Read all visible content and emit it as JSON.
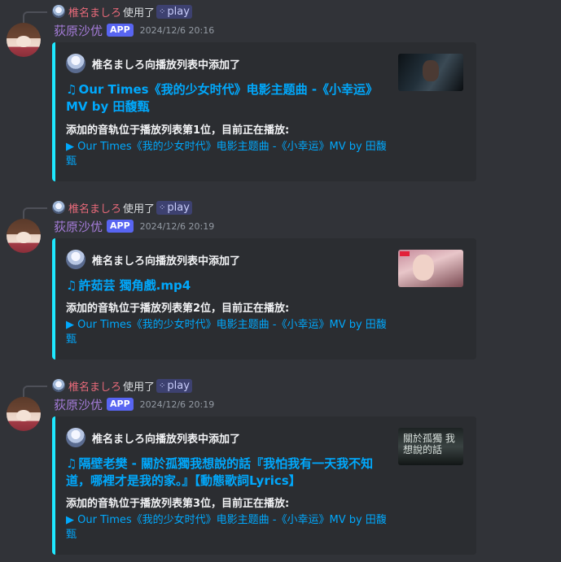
{
  "messages": [
    {
      "reply": {
        "user": "椎名ましろ",
        "verb": "使用了",
        "command": "play"
      },
      "author": {
        "name": "荻原沙优",
        "badge": "APP",
        "timestamp": "2024/12/6 20:16"
      },
      "embed": {
        "author_text": "椎名ましろ向播放列表中添加了",
        "title_icon": "♫",
        "title": "Our Times《我的少女时代》电影主题曲 -《小幸运》MV by 田馥甄",
        "field_name": "添加的音轨位于播放列表第1位，目前正在播放:",
        "field_value": "▶ Our Times《我的少女时代》电影主题曲 -《小幸运》MV by 田馥甄"
      }
    },
    {
      "reply": {
        "user": "椎名ましろ",
        "verb": "使用了",
        "command": "play"
      },
      "author": {
        "name": "荻原沙优",
        "badge": "APP",
        "timestamp": "2024/12/6 20:19"
      },
      "embed": {
        "author_text": "椎名ましろ向播放列表中添加了",
        "title_icon": "♫",
        "title": "許茹芸 獨角戲.mp4",
        "field_name": "添加的音轨位于播放列表第2位，目前正在播放:",
        "field_value": "▶ Our Times《我的少女时代》电影主题曲 -《小幸运》MV by 田馥甄"
      }
    },
    {
      "reply": {
        "user": "椎名ましろ",
        "verb": "使用了",
        "command": "play"
      },
      "author": {
        "name": "荻原沙优",
        "badge": "APP",
        "timestamp": "2024/12/6 20:19"
      },
      "embed": {
        "author_text": "椎名ましろ向播放列表中添加了",
        "title_icon": "♫",
        "title": "隔壁老樊 - 關於孤獨我想說的話『我怕我有一天我不知道，哪裡才是我的家。』【動態歌詞Lyrics】",
        "field_name": "添加的音轨位于播放列表第3位，目前正在播放:",
        "field_value": "▶ Our Times《我的少女时代》电影主题曲 -《小幸运》MV by 田馥甄",
        "thumb_text": "關於孤獨 我想說的話"
      }
    }
  ]
}
